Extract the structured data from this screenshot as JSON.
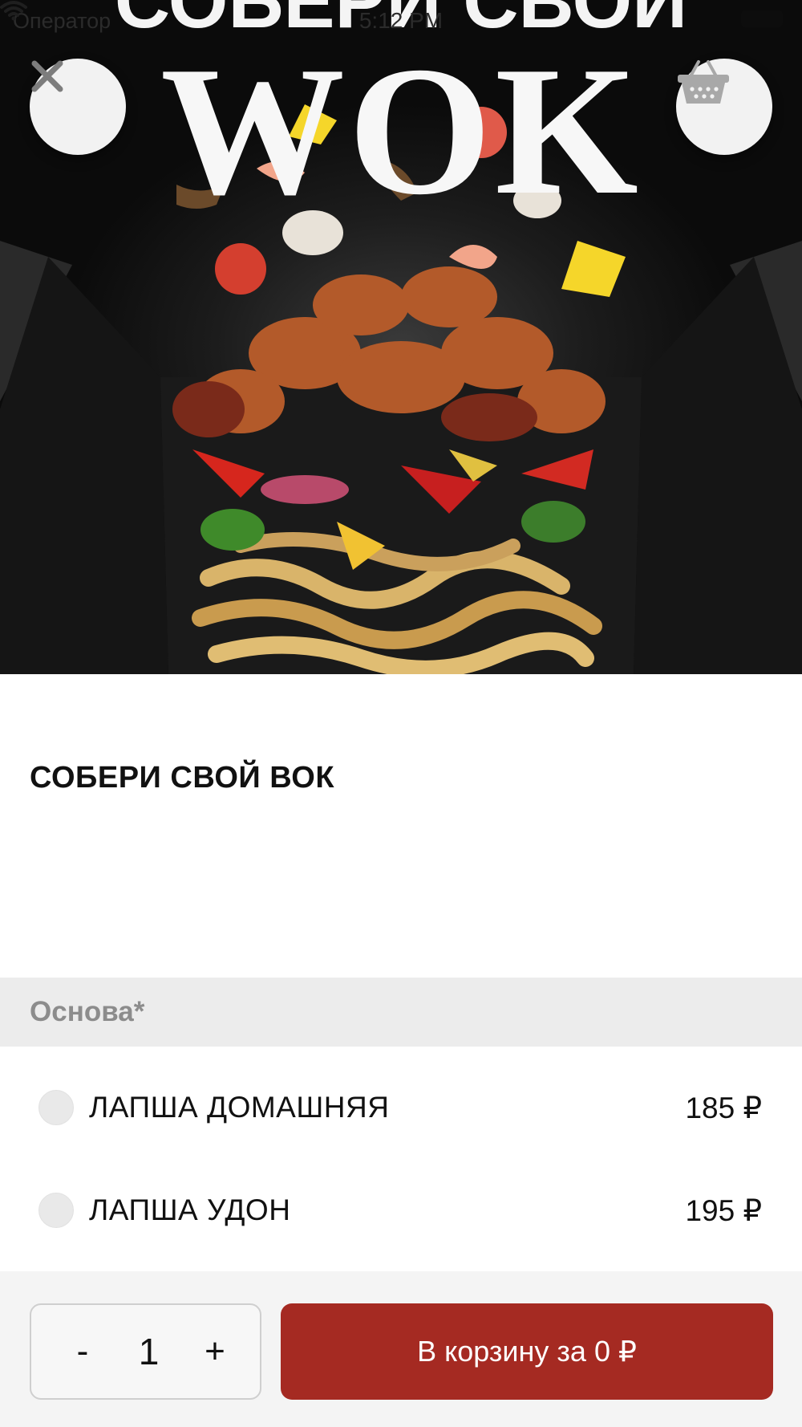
{
  "status_bar": {
    "carrier": "Оператор",
    "time": "5:12 PM"
  },
  "hero": {
    "image_text_top": "СОБЕРИ СВОЙ",
    "image_text_main": "WOK"
  },
  "product": {
    "title": "СОБЕРИ СВОЙ ВОК"
  },
  "section": {
    "title": "Основа*"
  },
  "options": [
    {
      "name": "ЛАПША ДОМАШНЯЯ",
      "price": "185 ₽",
      "selected": false
    },
    {
      "name": "ЛАПША УДОН",
      "price": "195 ₽",
      "selected": false
    }
  ],
  "quantity": {
    "minus": "-",
    "value": "1",
    "plus": "+"
  },
  "add_to_cart": {
    "label": "В корзину за 0 ₽"
  },
  "colors": {
    "accent": "#a52a22",
    "section_bg": "#ececec"
  },
  "icons": {
    "close": "close-icon",
    "cart": "basket-icon",
    "wifi": "wifi-icon",
    "battery": "battery-icon"
  }
}
